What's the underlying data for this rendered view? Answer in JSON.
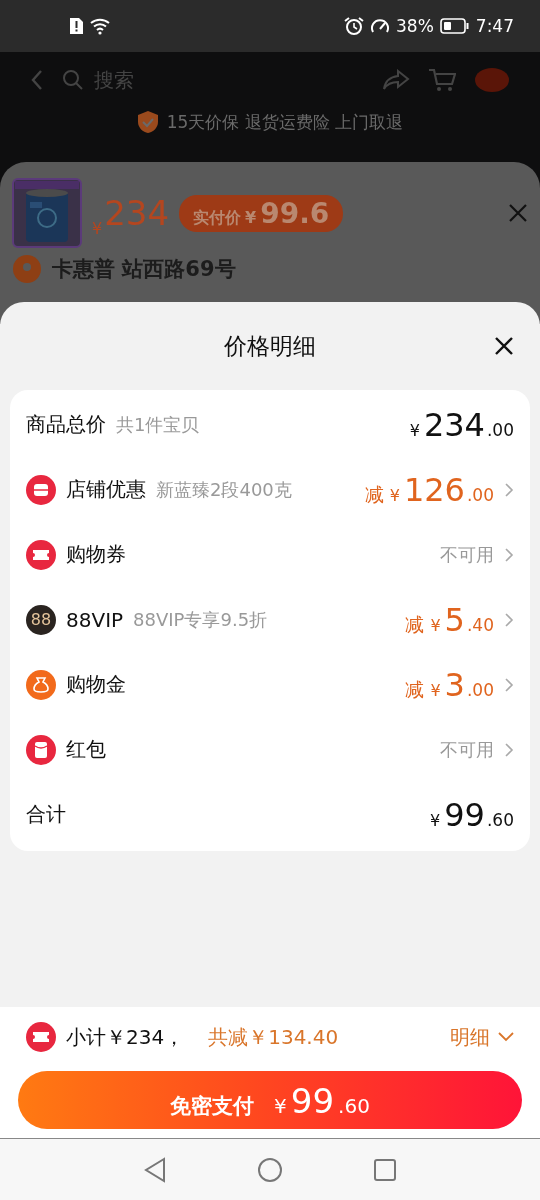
{
  "status_bar": {
    "battery": "38%",
    "time": "7:47"
  },
  "background": {
    "search": {
      "placeholder": "搜索"
    },
    "guarantee": "15天价保 退货运费险 上门取退",
    "product_sheet": {
      "currency": "¥",
      "price": "234",
      "badge_label": "实付价",
      "badge_currency": "¥",
      "badge_price": "99.6",
      "address": "卡惠普 站西路69号"
    }
  },
  "sheet": {
    "title": "价格明细",
    "rows": [
      {
        "kind": "subtotal",
        "label": "商品总价",
        "note": "共1件宝贝",
        "currency": "¥",
        "integer": "234",
        "decimal": ".00"
      },
      {
        "kind": "discount",
        "label": "店铺优惠",
        "note": "新蓝臻2段400克",
        "prefix": "减",
        "currency": "¥",
        "integer": "126",
        "decimal": ".00"
      },
      {
        "kind": "unavailable",
        "label": "购物券",
        "status": "不可用"
      },
      {
        "kind": "discount",
        "badge": "88",
        "label": "88VIP",
        "note": "88VIP专享9.5折",
        "prefix": "减",
        "currency": "¥",
        "integer": "5",
        "decimal": ".40"
      },
      {
        "kind": "discount",
        "label": "购物金",
        "prefix": "减",
        "currency": "¥",
        "integer": "3",
        "decimal": ".00"
      },
      {
        "kind": "unavailable",
        "label": "红包",
        "status": "不可用"
      },
      {
        "kind": "total",
        "label": "合计",
        "currency": "¥",
        "integer": "99",
        "decimal": ".60"
      }
    ]
  },
  "footer": {
    "subtotal": "小计￥234，",
    "saved": "共减￥134.40",
    "details": "明细",
    "pay": {
      "label": "免密支付",
      "currency": "¥",
      "integer": "99",
      "decimal": ".60"
    }
  }
}
